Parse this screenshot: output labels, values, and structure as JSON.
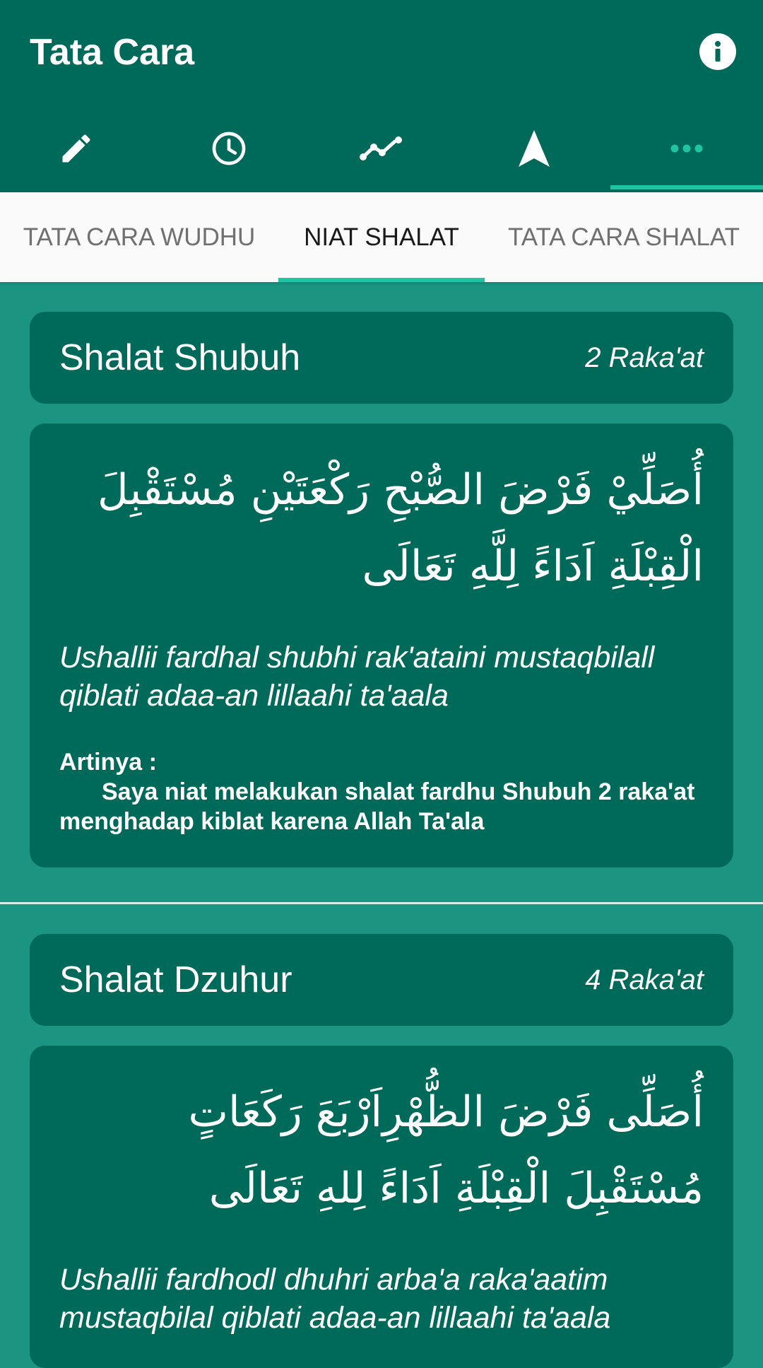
{
  "header": {
    "title": "Tata Cara",
    "info_icon": "info-icon"
  },
  "icon_tabs": [
    {
      "icon": "pencil-icon",
      "active": false
    },
    {
      "icon": "clock-icon",
      "active": false
    },
    {
      "icon": "trending-line-icon",
      "active": false
    },
    {
      "icon": "navigation-arrow-icon",
      "active": false
    },
    {
      "icon": "more-horizontal-icon",
      "active": true
    }
  ],
  "text_tabs": [
    {
      "label": "TATA CARA WUDHU",
      "active": false
    },
    {
      "label": "NIAT SHALAT",
      "active": true
    },
    {
      "label": "TATA CARA SHALAT",
      "active": false
    }
  ],
  "colors": {
    "primary_dark": "#006a5a",
    "background": "#1b9482",
    "accent": "#1fc4a3"
  },
  "prayers": [
    {
      "name": "Shalat Shubuh",
      "rakaat": "2 Raka'at",
      "arabic": "أُصَلِّيْ فَرْضَ الصُّبْحِ رَكْعَتَيْنِ مُسْتَقْبِلَ الْقِبْلَةِ اَدَاءً لِلَّهِ تَعَالَى",
      "latin": "Ushallii fardhal shubhi rak'ataini mustaqbilall qiblati adaa-an lillaahi ta'aala",
      "meaning_label": "Artinya :",
      "meaning": "Saya niat melakukan shalat fardhu Shubuh 2 raka'at menghadap kiblat karena Allah Ta'ala"
    },
    {
      "name": "Shalat Dzuhur",
      "rakaat": "4 Raka'at",
      "arabic": "أُصَلِّى فَرْضَ الظُّهْرِاَرْبَعَ رَكَعَاتٍ مُسْتَقْبِلَ الْقِبْلَةِ اَدَاءً لِلهِ تَعَالَى",
      "latin": "Ushallii fardhodl dhuhri arba'a raka'aatim mustaqbilal qiblati adaa-an lillaahi ta'aala"
    }
  ]
}
